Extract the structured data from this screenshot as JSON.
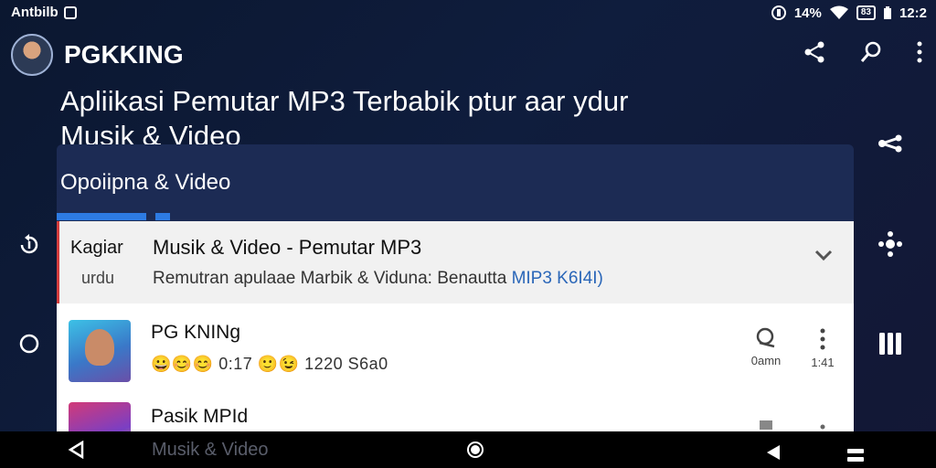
{
  "status_bar": {
    "carrier": "Antbilb",
    "signal_text": "14%",
    "battery_label": "83",
    "time": "12:2"
  },
  "header": {
    "channel_name": "PGKKING",
    "title_line1": "Apliikasi Pemutar MP3 Terbabik ptur aar ydur",
    "title_line2": "Musik & Video"
  },
  "card": {
    "title": "Opoiipna & Video",
    "selected_row": {
      "label_top": "Kagiar",
      "label_bottom": "urdu",
      "title": "Musik & Video - Pemutar MP3",
      "subtitle_main": "Remutran apulaae Marbik & Viduna: Benautta ",
      "subtitle_highlight": "MIP3 K6I4I)"
    },
    "items": [
      {
        "name": "PG KNINg",
        "meta": "😀😊😊 0:17  🙂😉  1220  S6a0",
        "action1_label": "0amn",
        "action2_label": "1:41"
      },
      {
        "name": "Pasik MPId",
        "meta": ""
      }
    ],
    "faded_text": "Musik & Video"
  },
  "icons": {
    "share": "share-icon",
    "search": "search-icon",
    "more": "more-icon",
    "rotate": "rotate-icon",
    "home_circle": "circle-icon",
    "pause": "pause-icon"
  },
  "colors": {
    "accent": "#2d7be3",
    "card_bg": "#1c2b54",
    "selected_row_bg": "#f1f1f1",
    "highlight_text": "#2a66b8"
  }
}
